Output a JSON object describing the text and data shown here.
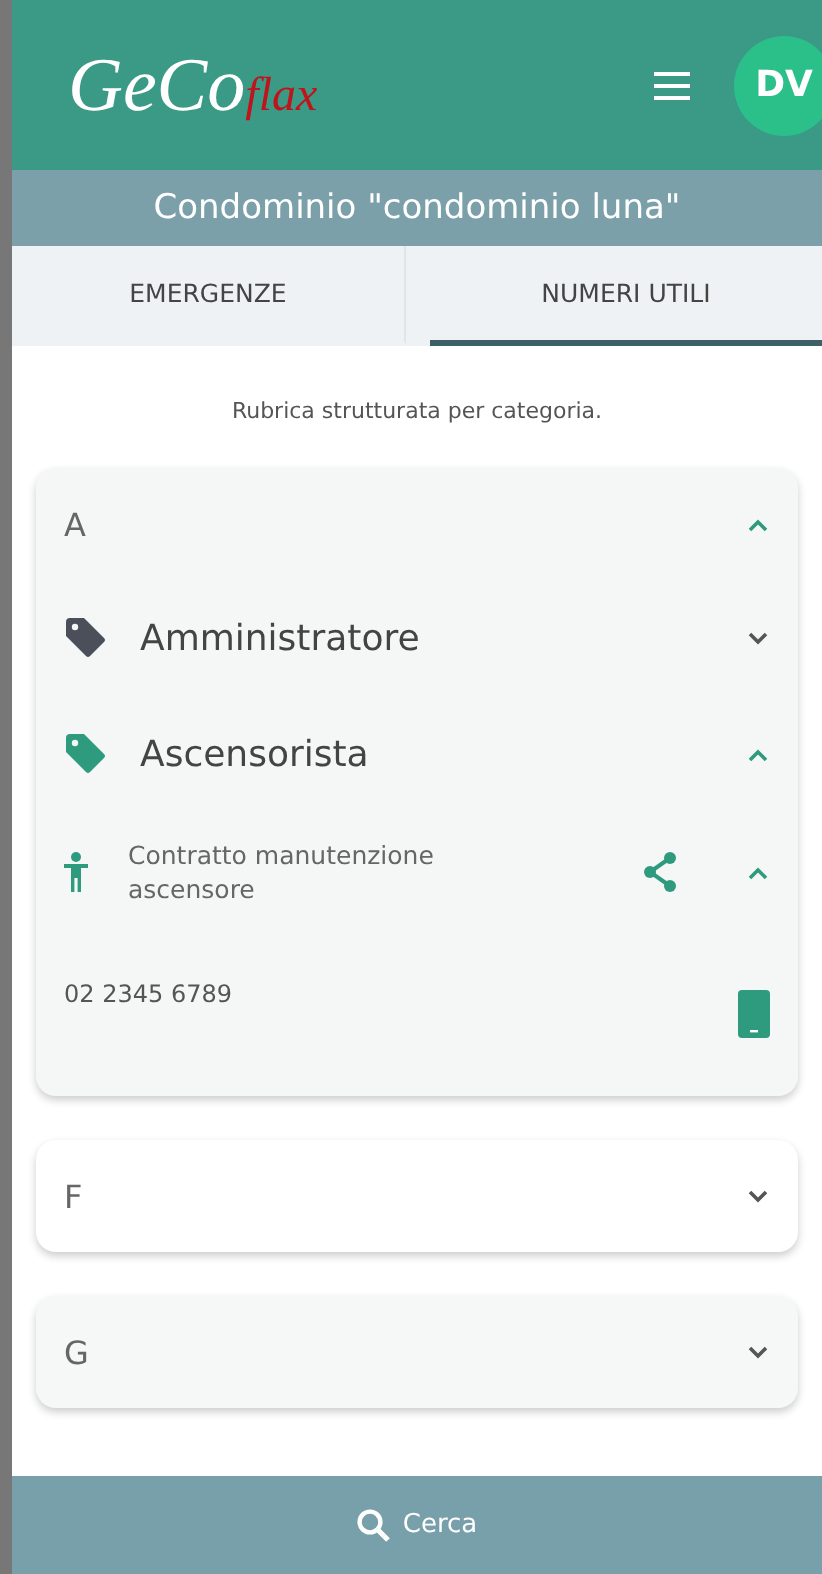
{
  "header": {
    "logo": {
      "main": "GeCo",
      "accent": "flax"
    },
    "avatar": "DV"
  },
  "subtitle": "Condominio \"condominio luna\"",
  "tabs": [
    {
      "label": "EMERGENZE",
      "selected": false
    },
    {
      "label": "NUMERI UTILI",
      "selected": true
    }
  ],
  "intro": "Rubrica strutturata per categoria.",
  "sections": [
    {
      "letter": "A",
      "expanded": true,
      "categories": [
        {
          "name": "Amministratore",
          "expanded": false,
          "color": "#4a4f5a"
        },
        {
          "name": "Ascensorista",
          "expanded": true,
          "color": "#2e9a7e",
          "contacts": [
            {
              "description": "Contratto manutenzione ascensore",
              "expanded": true,
              "phone": "02 2345 6789"
            }
          ]
        }
      ]
    },
    {
      "letter": "F",
      "expanded": false
    },
    {
      "letter": "G",
      "expanded": false
    }
  ],
  "search_button": "Cerca"
}
